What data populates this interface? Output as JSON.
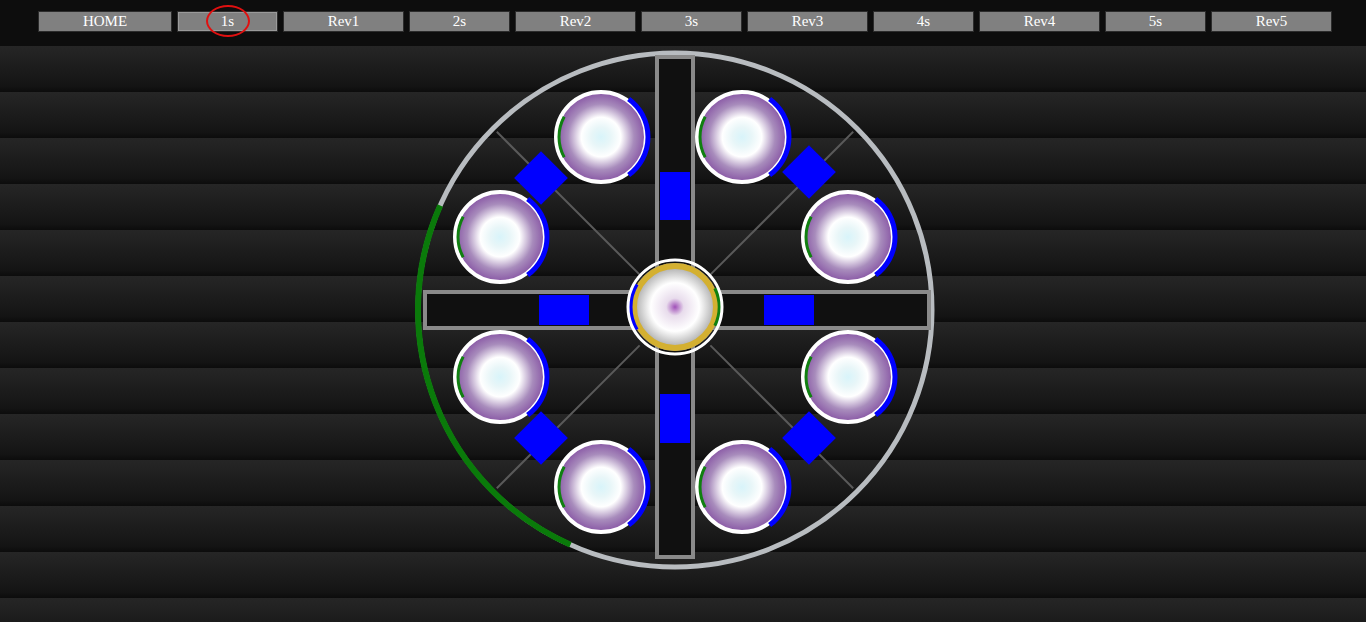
{
  "nav": [
    {
      "label": "HOME",
      "kind": "home",
      "selected": false
    },
    {
      "label": "1s",
      "kind": "step",
      "selected": true
    },
    {
      "label": "Rev1",
      "kind": "rev",
      "selected": false
    },
    {
      "label": "2s",
      "kind": "step",
      "selected": false
    },
    {
      "label": "Rev2",
      "kind": "rev",
      "selected": false
    },
    {
      "label": "3s",
      "kind": "step",
      "selected": false
    },
    {
      "label": "Rev3",
      "kind": "rev",
      "selected": false
    },
    {
      "label": "4s",
      "kind": "step",
      "selected": false
    },
    {
      "label": "Rev4",
      "kind": "rev",
      "selected": false
    },
    {
      "label": "5s",
      "kind": "step",
      "selected": false
    },
    {
      "label": "Rev5",
      "kind": "rev",
      "selected": false
    }
  ],
  "ring": {
    "level": 0.25
  },
  "hub": {
    "level": 0.17,
    "secondary_level": 0.14
  },
  "nodes": [
    {
      "level": 0.3,
      "secondary_level": 0.16
    },
    {
      "level": 0.3,
      "secondary_level": 0.16
    },
    {
      "level": 0.3,
      "secondary_level": 0.16
    },
    {
      "level": 0.3,
      "secondary_level": 0.16
    },
    {
      "level": 0.3,
      "secondary_level": 0.16
    },
    {
      "level": 0.3,
      "secondary_level": 0.16
    },
    {
      "level": 0.3,
      "secondary_level": 0.16
    },
    {
      "level": 0.3,
      "secondary_level": 0.16
    }
  ]
}
